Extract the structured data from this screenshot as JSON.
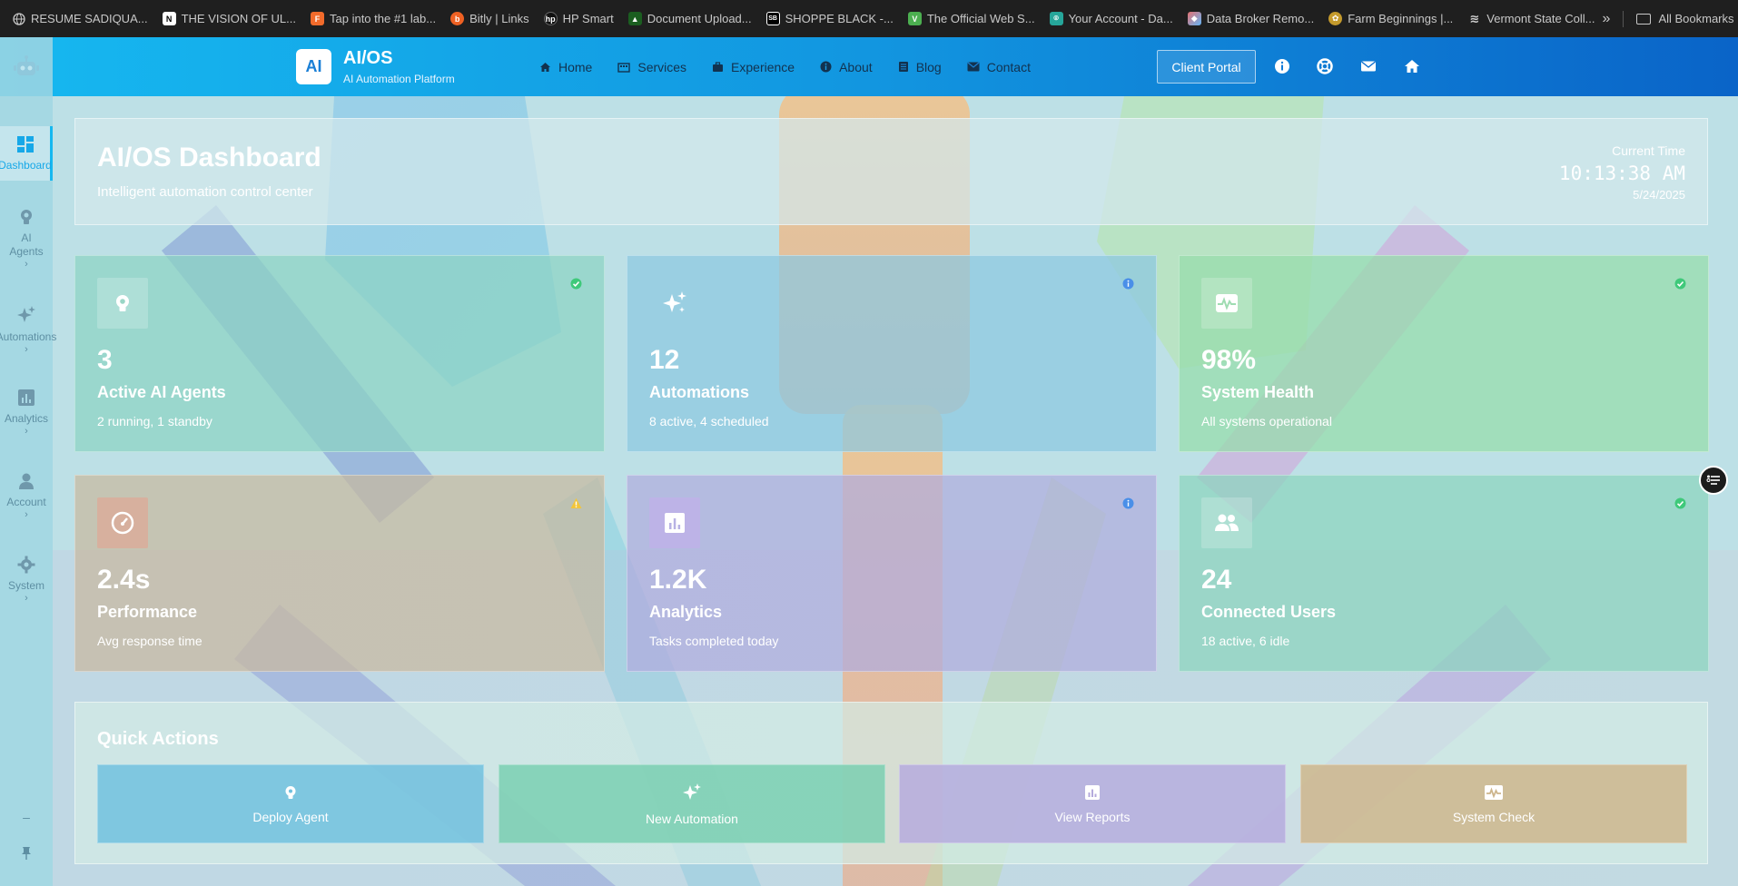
{
  "bookmarks": {
    "items": [
      {
        "label": "RESUME SADIQUA...",
        "icon": "globe-icon",
        "color": "#888888"
      },
      {
        "label": "THE VISION OF UL...",
        "icon": "notion-icon",
        "color": "#ffffff"
      },
      {
        "label": "Tap into the #1 lab...",
        "icon": "framer-icon",
        "color": "#f26b2b"
      },
      {
        "label": "Bitly | Links",
        "icon": "bitly-icon",
        "color": "#ee6123"
      },
      {
        "label": "HP Smart",
        "icon": "hp-icon",
        "color": "#2b2b2b"
      },
      {
        "label": "Document Upload...",
        "icon": "document-icon",
        "color": "#2e7d32"
      },
      {
        "label": "SHOPPE BLACK -...",
        "icon": "sb-icon",
        "color": "#000000"
      },
      {
        "label": "The Official Web S...",
        "icon": "state-icon",
        "color": "#4caf50"
      },
      {
        "label": "Your Account - Da...",
        "icon": "pin-icon",
        "color": "#26a69a"
      },
      {
        "label": "Data Broker Remo...",
        "icon": "data-icon",
        "color": "#e57373"
      },
      {
        "label": "Farm Beginnings |...",
        "icon": "farm-icon",
        "color": "#c49a2c"
      },
      {
        "label": "Vermont State Coll...",
        "icon": "vermont-icon",
        "color": "#d0d0d0"
      }
    ],
    "overflow_label": "»",
    "all_bookmarks_label": "All Bookmarks"
  },
  "header": {
    "logo_text": "AI",
    "brand_title": "AI/OS",
    "brand_subtitle": "AI Automation Platform",
    "nav": [
      {
        "label": "Home",
        "icon": "home-icon"
      },
      {
        "label": "Services",
        "icon": "building-icon"
      },
      {
        "label": "Experience",
        "icon": "briefcase-icon"
      },
      {
        "label": "About",
        "icon": "info-icon"
      },
      {
        "label": "Blog",
        "icon": "newspaper-icon"
      },
      {
        "label": "Contact",
        "icon": "envelope-icon"
      }
    ],
    "client_portal_label": "Client Portal",
    "right_icons": [
      "info-icon",
      "lifebuoy-icon",
      "envelope-icon",
      "home-icon"
    ]
  },
  "sidebar": {
    "logo_icon": "robot-icon",
    "items": [
      {
        "label": "Dashboard",
        "icon": "dashboard-icon",
        "active": true,
        "chevron": ""
      },
      {
        "label": "AI Agents",
        "icon": "brain-icon",
        "active": false,
        "chevron": "›"
      },
      {
        "label": "Automations",
        "icon": "sparkles-icon",
        "active": false,
        "chevron": "›"
      },
      {
        "label": "Analytics",
        "icon": "chart-icon",
        "active": false,
        "chevron": "›"
      },
      {
        "label": "Account",
        "icon": "user-icon",
        "active": false,
        "chevron": "›"
      },
      {
        "label": "System",
        "icon": "gear-icon",
        "active": false,
        "chevron": "›"
      }
    ],
    "bottom_minus": "–",
    "pin_icon": "pin-icon"
  },
  "hero": {
    "title": "AI/OS Dashboard",
    "subtitle": "Intelligent automation control center",
    "time_label": "Current Time",
    "time_value": "10:13:38 AM",
    "date_value": "5/24/2025"
  },
  "cards": [
    {
      "value": "3",
      "label": "Active AI Agents",
      "desc": "2 running, 1 standby",
      "icon": "brain-icon",
      "status": "check-icon",
      "status_color": "#3fc97a",
      "tint": "#9dd7c8"
    },
    {
      "value": "12",
      "label": "Automations",
      "desc": "8 active, 4 scheduled",
      "icon": "sparkles-icon",
      "status": "info-icon",
      "status_color": "#4a8fe8",
      "tint": "#9dcbe0"
    },
    {
      "value": "98%",
      "label": "System Health",
      "desc": "All systems operational",
      "icon": "heartbeat-icon",
      "status": "check-icon",
      "status_color": "#3fc97a",
      "tint": "#a8e0b4"
    },
    {
      "value": "2.4s",
      "label": "Performance",
      "desc": "Avg response time",
      "icon": "gauge-icon",
      "status": "warning-icon",
      "status_color": "#f3c53a",
      "tint": "#c9bfa8"
    },
    {
      "value": "1.2K",
      "label": "Analytics",
      "desc": "Tasks completed today",
      "icon": "chart-icon",
      "status": "info-icon",
      "status_color": "#4a8fe8",
      "tint": "#b8b6e0"
    },
    {
      "value": "24",
      "label": "Connected Users",
      "desc": "18 active, 6 idle",
      "icon": "users-icon",
      "status": "check-icon",
      "status_color": "#3fc97a",
      "tint": "#9dd8c4"
    }
  ],
  "quick_actions": {
    "title": "Quick Actions",
    "buttons": [
      {
        "label": "Deploy Agent",
        "icon": "brain-icon",
        "color": "#7ec8dd"
      },
      {
        "label": "New Automation",
        "icon": "sparkles-icon",
        "color": "#86d2b8"
      },
      {
        "label": "View Reports",
        "icon": "chart-icon",
        "color": "#b7b4dd"
      },
      {
        "label": "System Check",
        "icon": "heartbeat-icon",
        "color": "#cdb893"
      }
    ]
  },
  "floating_button_icon": "list-icon"
}
